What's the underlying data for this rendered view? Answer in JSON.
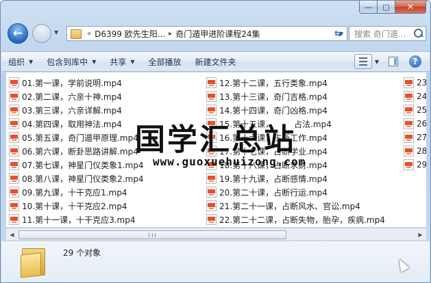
{
  "window": {
    "minimize": "—",
    "maximize": "□",
    "close": "✕"
  },
  "nav": {
    "back_icon": "←",
    "forward_icon": "→",
    "dropdown_icon": "▼",
    "refresh_icon": "⇆"
  },
  "address": {
    "sep1": "«",
    "segment1": "D6399 欧先生阳...",
    "sep2": "▸",
    "segment2": "奇门遁甲进阶课程24集",
    "dropdown_icon": "▼"
  },
  "search": {
    "placeholder": "搜索 奇门遁..."
  },
  "toolbar": {
    "organize": "组织",
    "include_in_library": "包含到库中",
    "share": "共享",
    "play_all": "全部播放",
    "new_folder": "新建文件夹",
    "dropdown_icon": "▼",
    "help": "?"
  },
  "files": {
    "col1": [
      "01.第一课，学前说明.mp4",
      "02.第二课，六亲十神.mp4",
      "03.第三课，六亲详解.mp4",
      "04.第四课，取用神法.mp4",
      "05.第五课，奇门遁甲原理.mp4",
      "06.第六课，断卦思路讲解.mp4",
      "07.第七课，神星门仪类象1.mp4",
      "08.第八课，神星门仪类象2.mp4",
      "09.第九课，十干克应1.mp4",
      "10.第十课，十干克应2.mp4",
      "11.第十一课，十干克应3.mp4"
    ],
    "col2": [
      "12.第十二课，五行类象.mp4",
      "13.第十三课，奇门吉格.mp4",
      "14.第十四课，奇门凶格.mp4",
      "15.第十五课，　　　占法.mp4",
      "16.第十六课，占断工作.mp4",
      "17.第十七课，占断学业.mp4",
      "18.第十八课，占断求财.mp4",
      "19.第十九课，占断感情.mp4",
      "20.第二十课，占断行运.mp4",
      "21.第二十一课，占断风水、官讼.mp4",
      "22.第二十二课，占断失物，胎孕，疾病.mp4"
    ],
    "col3": [
      "23",
      "24",
      "25",
      "26",
      "27",
      "28",
      "29"
    ]
  },
  "watermark": {
    "title": "国学汇总站",
    "url": "www.guoxuehuizong.com"
  },
  "status": {
    "count": "29 个对象"
  },
  "colors": {
    "chrome_blue": "#b9d2ec",
    "close_red": "#c3452a",
    "mp4_icon_red": "#e5512e"
  }
}
